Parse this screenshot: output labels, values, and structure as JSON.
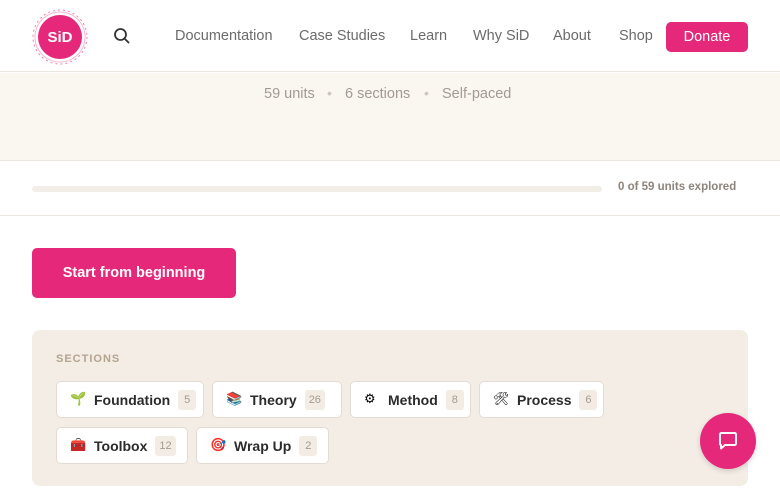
{
  "brand": {
    "logo_text": "SiD",
    "accent": "#e5287a"
  },
  "nav": {
    "items": [
      "Documentation",
      "Case Studies",
      "Learn",
      "Why SiD",
      "About",
      "Shop"
    ],
    "donate_label": "Donate"
  },
  "course_meta": {
    "units": "59 units",
    "sections": "6 sections",
    "pace": "Self-paced",
    "separator": "•"
  },
  "progress": {
    "text": "0 of 59 units explored",
    "value": 0
  },
  "start_button": {
    "label": "Start from beginning"
  },
  "sections": {
    "heading": "SECTIONS",
    "items": [
      {
        "emoji": "🌱",
        "label": "Foundation",
        "count": "5"
      },
      {
        "emoji": "📚",
        "label": "Theory",
        "count": "26"
      },
      {
        "emoji": "⚙",
        "label": "Method",
        "count": "8"
      },
      {
        "emoji": "🛠",
        "label": "Process",
        "count": "6"
      },
      {
        "emoji": "🧰",
        "label": "Toolbox",
        "count": "12"
      },
      {
        "emoji": "🎯",
        "label": "Wrap Up",
        "count": "2"
      }
    ]
  },
  "icons": {
    "search": "search-icon",
    "chat": "chat-icon"
  }
}
